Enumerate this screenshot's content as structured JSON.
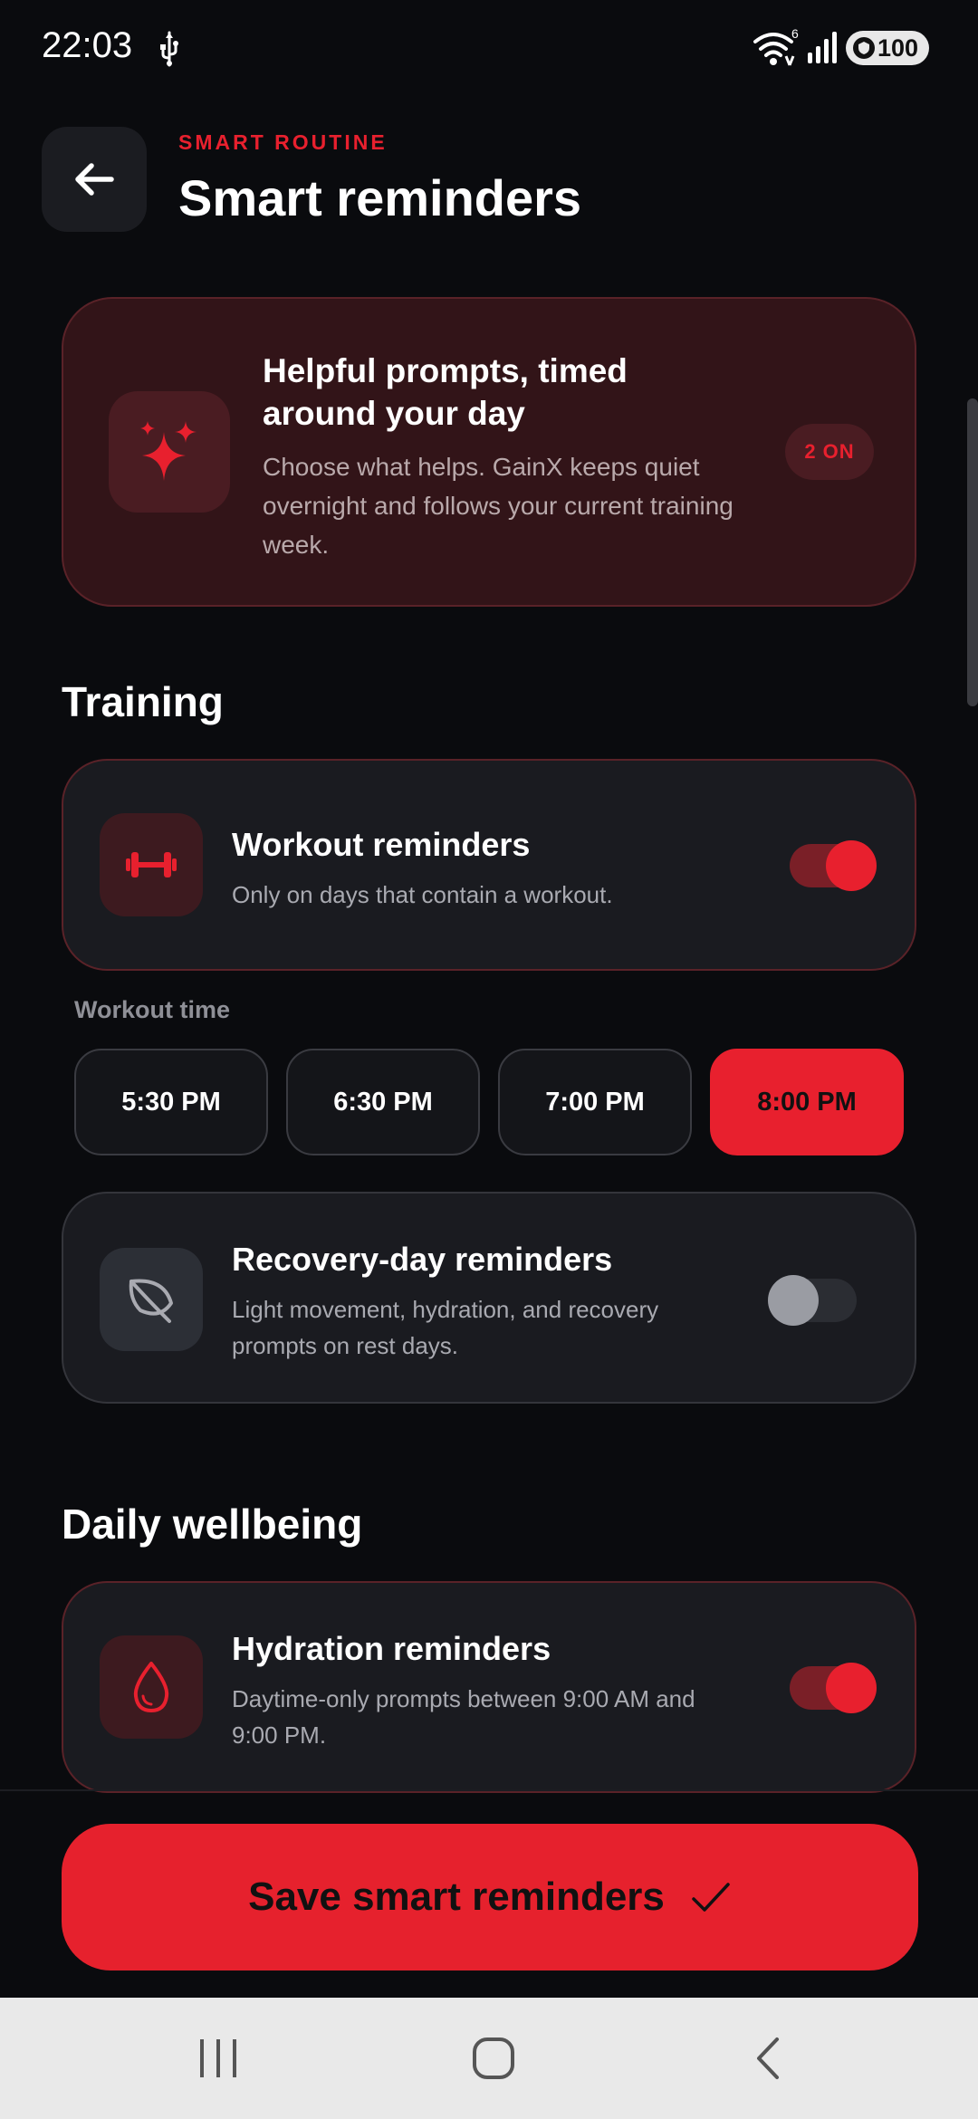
{
  "status_bar": {
    "time": "22:03",
    "wifi_badge": "6",
    "battery": "100",
    "icons": [
      "usb-icon",
      "wifi-icon",
      "signal-icon",
      "shield-icon"
    ]
  },
  "header": {
    "eyebrow": "SMART ROUTINE",
    "title": "Smart reminders",
    "back_icon": "arrow-left-icon"
  },
  "hero": {
    "title": "Helpful prompts, timed around your day",
    "description": "Choose what helps. GainX keeps quiet overnight and follows your current training week.",
    "badge": "2 ON",
    "icon": "sparkles-icon"
  },
  "sections": {
    "training": "Training",
    "wellbeing": "Daily wellbeing"
  },
  "workout": {
    "title": "Workout reminders",
    "description": "Only on days that contain a workout.",
    "enabled": true,
    "icon": "dumbbell-icon",
    "time_label": "Workout time",
    "times": [
      "5:30 PM",
      "6:30 PM",
      "7:00 PM",
      "8:00 PM"
    ],
    "selected_time": "8:00 PM"
  },
  "recovery": {
    "title": "Recovery-day reminders",
    "description": "Light movement, hydration, and recovery prompts on rest days.",
    "enabled": false,
    "icon": "leaf-icon"
  },
  "hydration": {
    "title": "Hydration reminders",
    "description": "Daytime-only prompts between 9:00 AM and 9:00 PM.",
    "enabled": true,
    "icon": "water-drop-icon"
  },
  "save_button": {
    "label": "Save smart reminders",
    "icon": "checkmark-icon"
  },
  "navigation": {
    "icons": [
      "recent-apps-icon",
      "home-icon",
      "back-icon"
    ]
  },
  "colors": {
    "accent": "#e8202e",
    "background": "#0a0b0e",
    "card": "#1a1b20",
    "hero_card": "#321418"
  }
}
